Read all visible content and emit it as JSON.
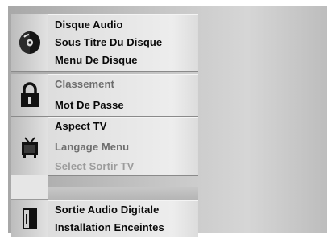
{
  "menu": {
    "groups": [
      {
        "icon": "disc-icon",
        "items": [
          {
            "label": "Disque Audio"
          },
          {
            "label": "Sous Titre Du Disque"
          },
          {
            "label": "Menu De Disque"
          }
        ]
      },
      {
        "icon": "padlock-icon",
        "items": [
          {
            "label": "Classement"
          },
          {
            "label": "Mot De Passe"
          }
        ]
      },
      {
        "icon": "tv-icon",
        "items": [
          {
            "label": "Aspect TV"
          },
          {
            "label": "Langage Menu"
          },
          {
            "label": "Select Sortir TV"
          }
        ]
      },
      {
        "icon": "speaker-icon",
        "items": [
          {
            "label": "Sortie Audio Digitale"
          },
          {
            "label": "Installation Enceintes"
          }
        ]
      }
    ]
  }
}
